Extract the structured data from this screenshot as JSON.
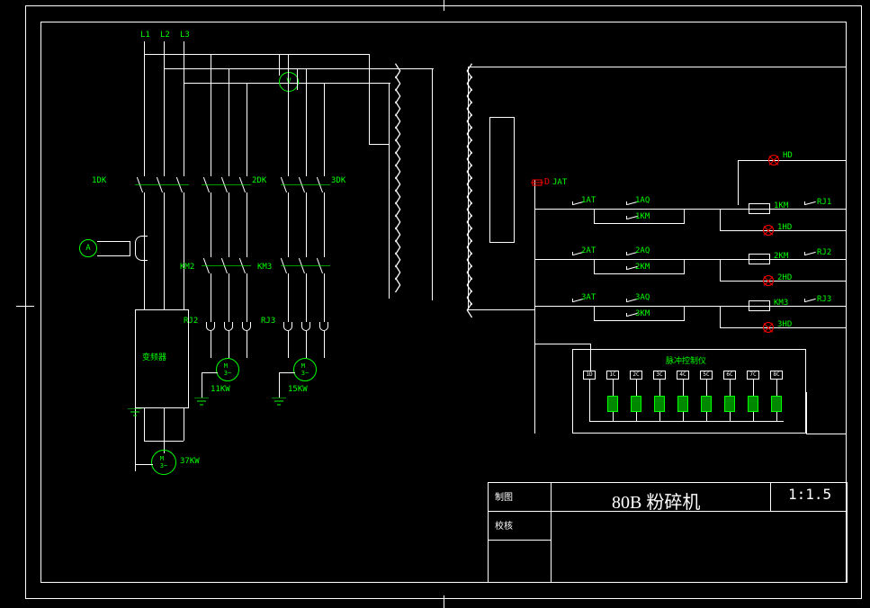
{
  "drawing": {
    "title_main": "80B 粉碎机",
    "scale": "1:1.5",
    "tb_row1": "制图",
    "tb_row2": "校核"
  },
  "power": {
    "l1": "L1",
    "l2": "L2",
    "l3": "L3"
  },
  "breakers": {
    "b1": "1DK",
    "b2": "2DK",
    "b3": "3DK"
  },
  "meters": {
    "ammeter": "A",
    "voltmeter": "V"
  },
  "contactors": {
    "km2": "KM2",
    "km3": "KM3"
  },
  "relays": {
    "rj2": "RJ2",
    "rj3": "RJ3"
  },
  "vfd": {
    "label": "变频器",
    "power": "37KW"
  },
  "motors": {
    "m2": "11KW",
    "m3": "15KW"
  },
  "control": {
    "jat": "JAT",
    "hd": "HD",
    "row1": {
      "at": "1AT",
      "aq": "1AQ",
      "km_aux": "1KM",
      "km_coil": "1KM",
      "hd": "1HD",
      "rj": "RJ1"
    },
    "row2": {
      "at": "2AT",
      "aq": "2AQ",
      "km_aux": "2KM",
      "km_coil": "2KM",
      "hd": "2HD",
      "rj": "RJ2"
    },
    "row3": {
      "at": "3AT",
      "aq": "3AQ",
      "km_aux": "3KM",
      "km_coil": "KM3",
      "hd": "3HD",
      "rj": "RJ3"
    },
    "pulse_controller": "脉冲控制仪",
    "d_label": "D"
  },
  "pulse_terms": [
    "1D",
    "1C",
    "2C",
    "3C",
    "4C",
    "5C",
    "6C",
    "7C",
    "8C"
  ]
}
